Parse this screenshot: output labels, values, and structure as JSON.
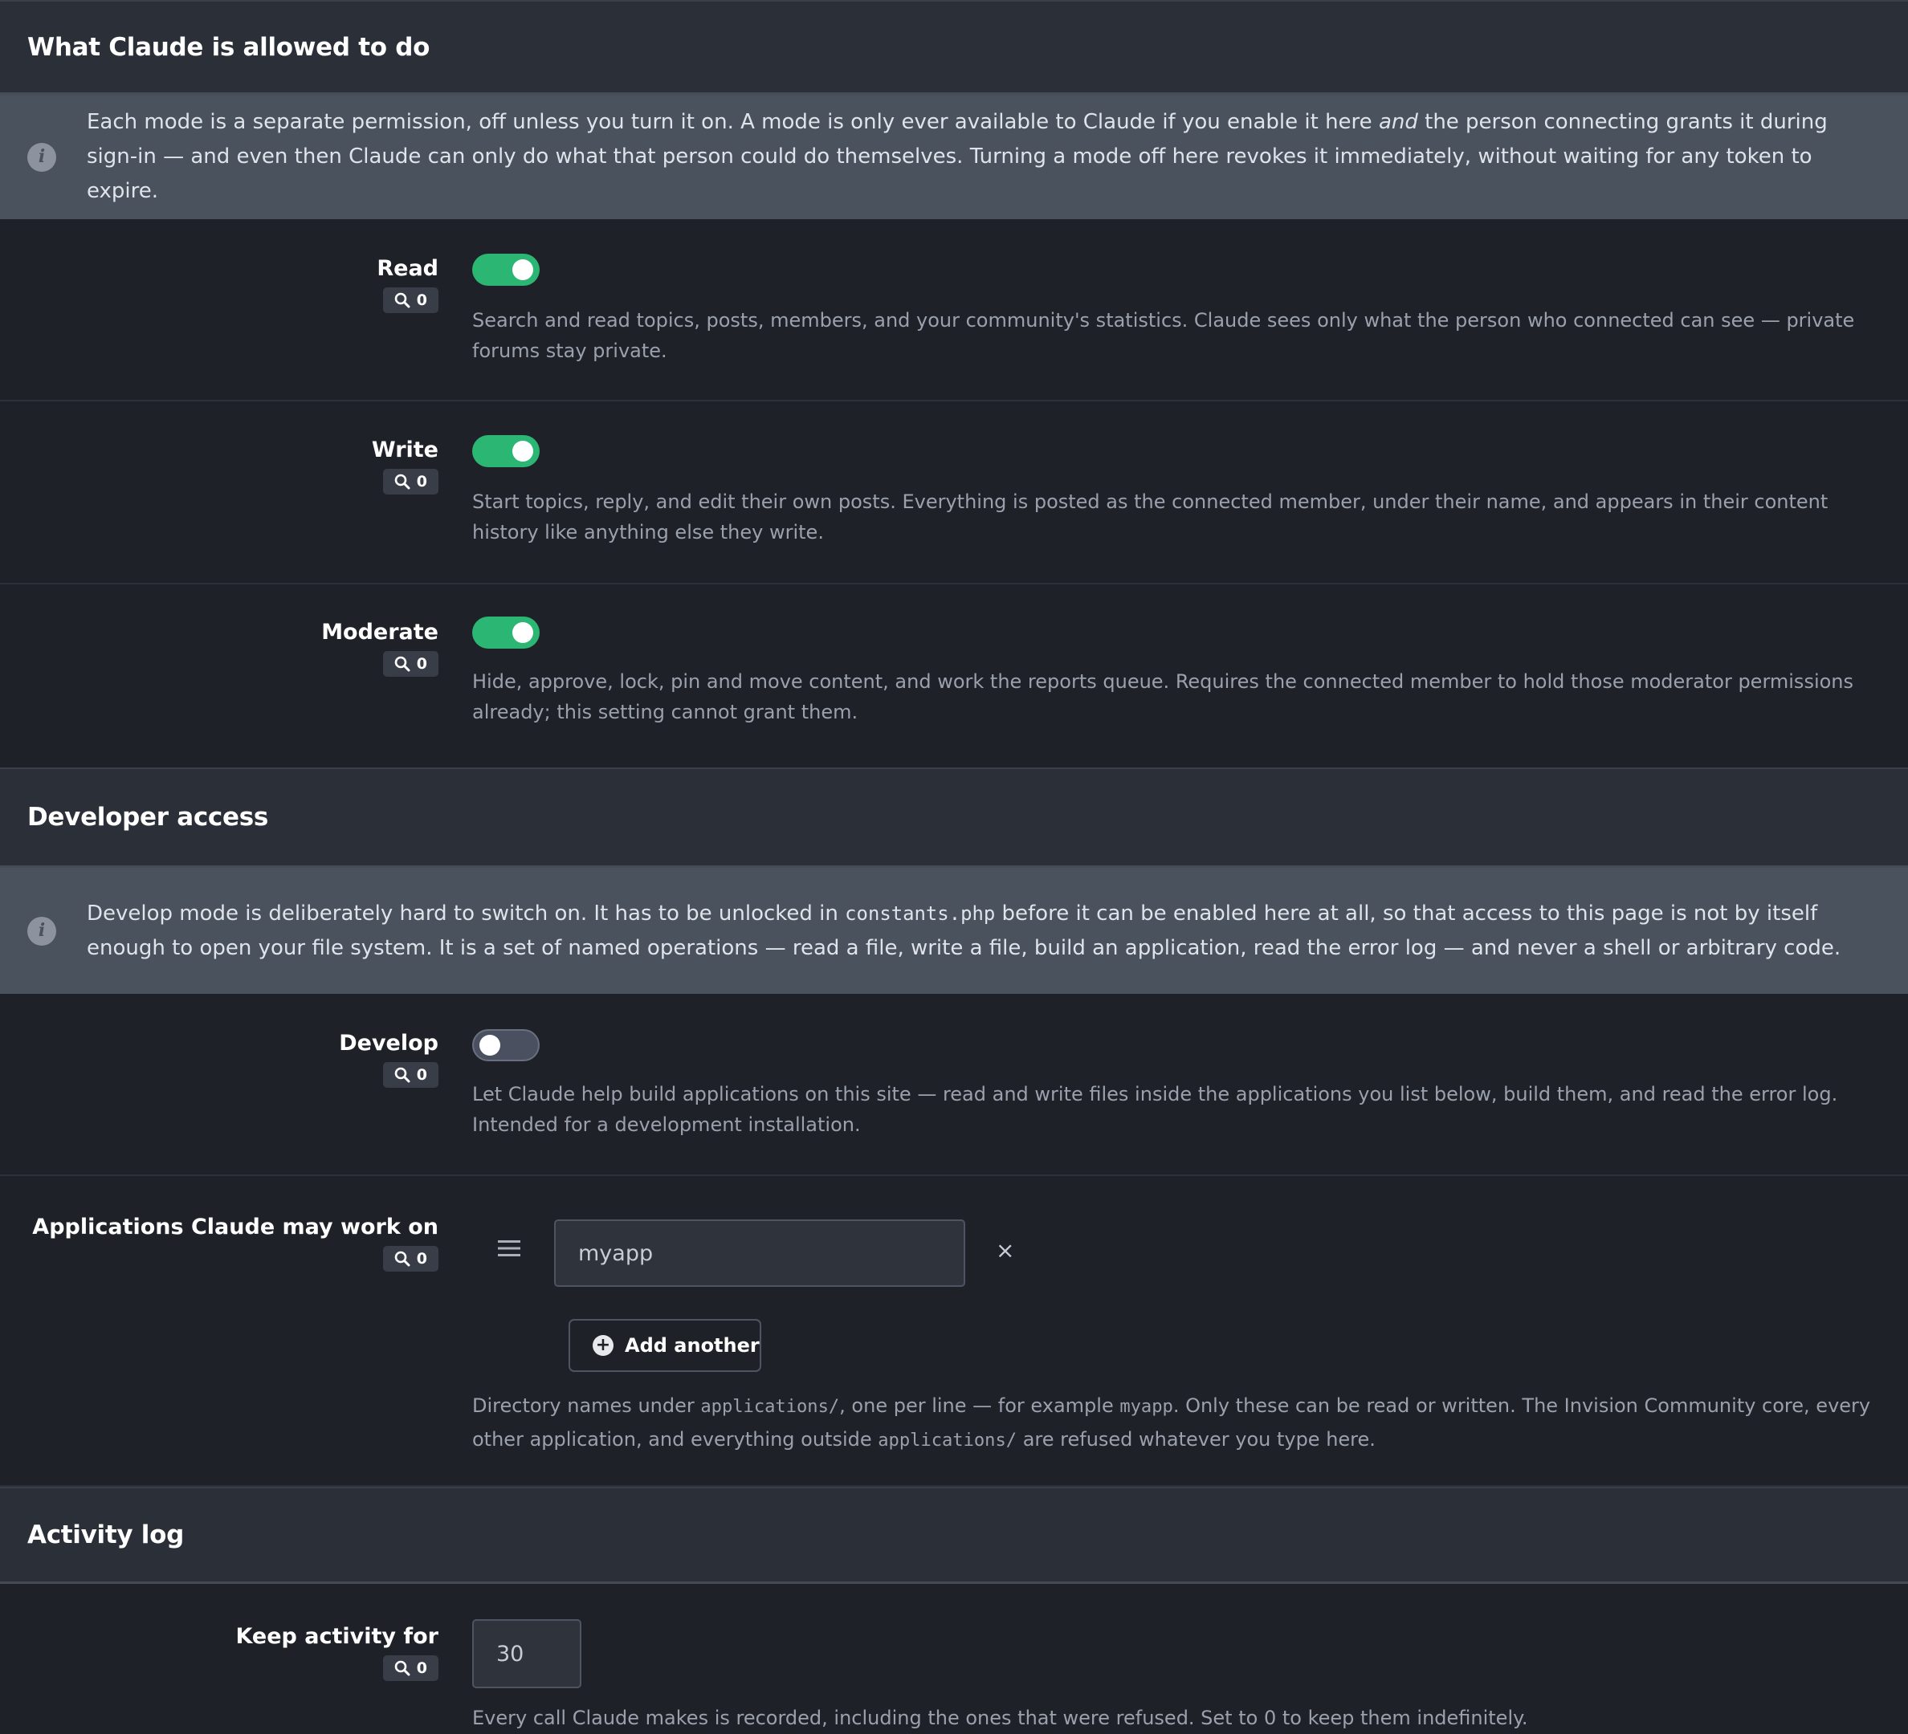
{
  "allowed": {
    "title": "What Claude is allowed to do",
    "info": {
      "part1": "Each mode is a separate permission, off unless you turn it on. A mode is only ever available to Claude if you enable it here ",
      "emphasis": "and",
      "part2": " the person connecting grants it during sign-in — and even then Claude can only do what that person could do themselves. Turning a mode off here revokes it immediately, without waiting for any token to expire."
    },
    "modes": [
      {
        "label": "Read",
        "badge": "0",
        "enabled": true,
        "description": "Search and read topics, posts, members, and your community's statistics. Claude sees only what the person who connected can see — private forums stay private."
      },
      {
        "label": "Write",
        "badge": "0",
        "enabled": true,
        "description": "Start topics, reply, and edit their own posts. Everything is posted as the connected member, under their name, and appears in their content history like anything else they write."
      },
      {
        "label": "Moderate",
        "badge": "0",
        "enabled": true,
        "description": "Hide, approve, lock, pin and move content, and work the reports queue. Requires the connected member to hold those moderator permissions already; this setting cannot grant them."
      }
    ]
  },
  "developer": {
    "title": "Developer access",
    "info": {
      "part1": "Develop mode is deliberately hard to switch on. It has to be unlocked in ",
      "code": "constants.php",
      "part2": " before it can be enabled here at all, so that access to this page is not by itself enough to open your file system. It is a set of named operations — read a file, write a file, build an application, read the error log — and never a shell or arbitrary code."
    },
    "develop": {
      "label": "Develop",
      "badge": "0",
      "enabled": false,
      "description": "Let Claude help build applications on this site — read and write files inside the applications you list below, build them, and read the error log. Intended for a development installation."
    },
    "applications": {
      "label": "Applications Claude may work on",
      "badge": "0",
      "value": "myapp",
      "remove_label": "×",
      "add_label": "Add another",
      "help": {
        "t1": "Directory names under ",
        "c1": "applications/",
        "t2": ", one per line — for example ",
        "c2": "myapp",
        "t3": ". Only these can be read or written. The Invision Community core, every other application, and everything outside ",
        "c3": "applications/",
        "t4": " are refused whatever you type here."
      }
    }
  },
  "activity": {
    "title": "Activity log",
    "keep": {
      "label": "Keep activity for",
      "badge": "0",
      "value": "30",
      "description": "Every call Claude makes is recorded, including the ones that were refused. Set to 0 to keep them indefinitely."
    }
  },
  "colors": {
    "toggle_on": "#2bb673",
    "toggle_off": "#4a5060",
    "info_bg": "#4a525e",
    "header_bg": "#2b2f38"
  },
  "icons": {
    "info": "info-icon",
    "search": "search-icon",
    "drag": "drag-handle-icon",
    "remove": "close-icon",
    "add": "plus-circle-icon"
  }
}
